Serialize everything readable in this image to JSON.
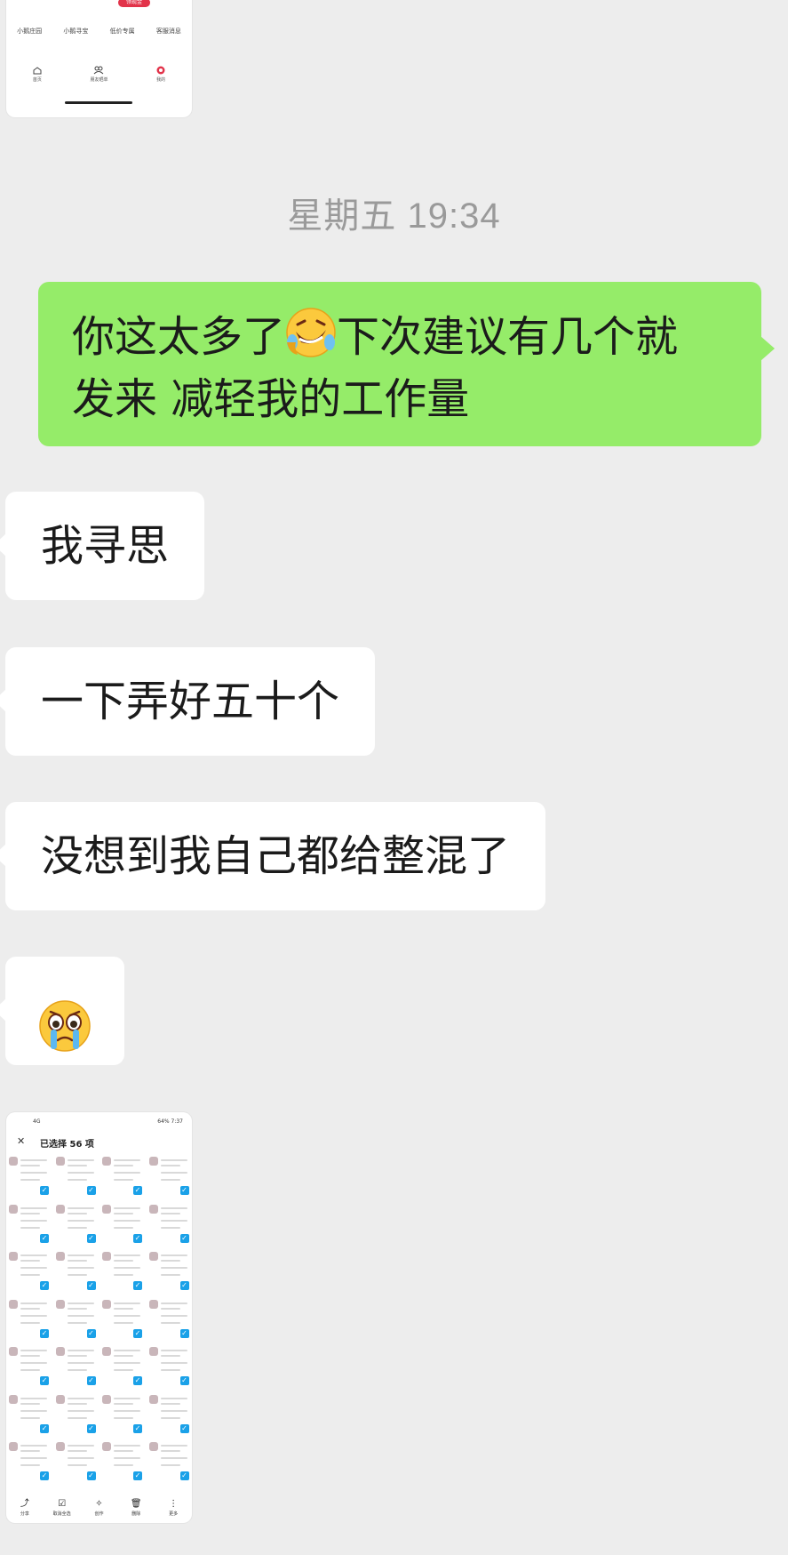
{
  "top_thumb": {
    "menu": [
      "小鹅庄园",
      "小鹅寻宝",
      "低价专属",
      "客服消息"
    ],
    "nav": [
      {
        "icon": "home-icon",
        "label": "首页"
      },
      {
        "icon": "friends-icon",
        "label": "朋友晒单"
      },
      {
        "icon": "profile-icon",
        "label": "我的"
      }
    ],
    "badge": "领现金"
  },
  "timestamp": "星期五 19:34",
  "messages": {
    "outgoing": {
      "line1_a": "你这太多了",
      "line1_b": "下次建议有几个就",
      "line2": "发来 减轻我的工作量",
      "emoji": "laughing-crying-emoji"
    },
    "incoming": [
      "我寻思",
      "一下弄好五十个",
      "没想到我自己都给整混了"
    ],
    "incoming_emoji": "crying-face-emoji"
  },
  "bottom_thumb": {
    "status_left": "4G",
    "status_right": "64% 7:37",
    "selection_title": "已选择 56 项",
    "tools": [
      {
        "icon": "share-icon",
        "label": "分享"
      },
      {
        "icon": "select-all-icon",
        "label": "取消全选"
      },
      {
        "icon": "create-icon",
        "label": "创作"
      },
      {
        "icon": "trash-icon",
        "label": "删除"
      },
      {
        "icon": "more-icon",
        "label": "更多"
      }
    ]
  },
  "colors": {
    "background": "#ededed",
    "outgoing_bubble": "#95ec69",
    "incoming_bubble": "#ffffff",
    "checkbox": "#1aa1e8"
  }
}
